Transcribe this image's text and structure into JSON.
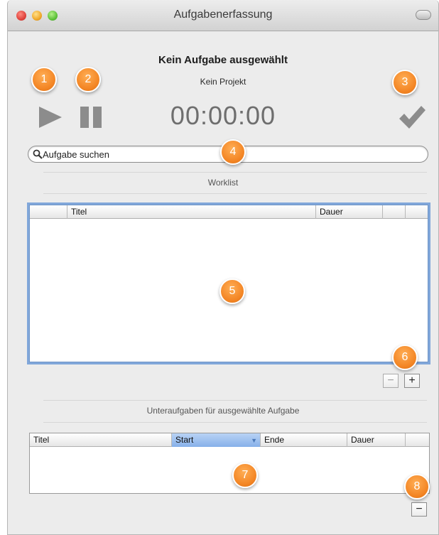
{
  "window": {
    "title": "Aufgabenerfassung"
  },
  "task": {
    "title": "Kein Aufgabe ausgewählt",
    "project": "Kein Projekt",
    "timer": "00:00:00"
  },
  "search": {
    "placeholder": "Aufgabe suchen"
  },
  "worklist": {
    "label": "Worklist",
    "columns": [
      "",
      "Titel",
      "Dauer",
      "",
      ""
    ],
    "rows": []
  },
  "worklist_buttons": {
    "remove": "−",
    "add": "+"
  },
  "subtasks": {
    "label": "Unteraufgaben für ausgewählte Aufgabe",
    "columns": [
      "Titel",
      "Start",
      "Ende",
      "Dauer",
      ""
    ],
    "sorted_column": "Start",
    "rows": []
  },
  "subtask_buttons": {
    "remove": "−"
  },
  "callouts": [
    "1",
    "2",
    "3",
    "4",
    "5",
    "6",
    "7",
    "8"
  ],
  "colors": {
    "callout": "#f38524",
    "focus_ring": "#6e9bd7",
    "sort_highlight": "#86b0e9"
  }
}
